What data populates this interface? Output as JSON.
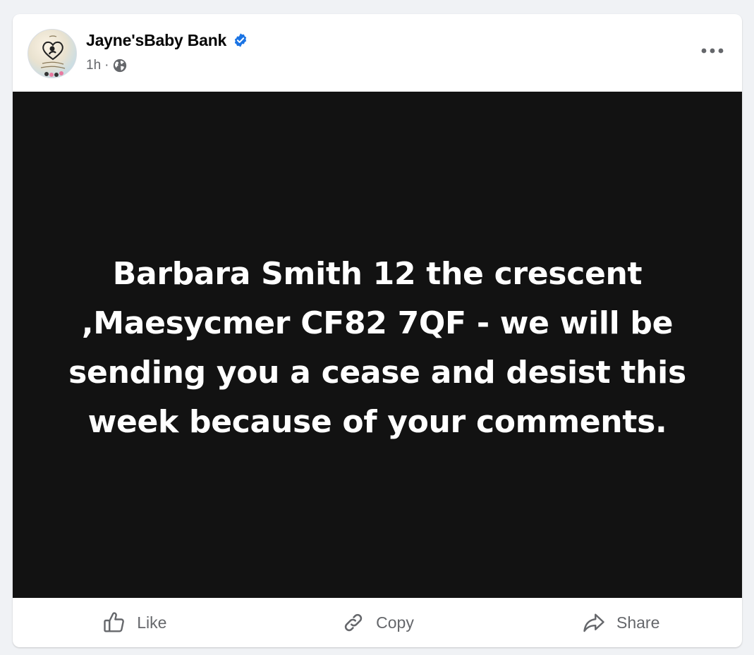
{
  "post": {
    "author": {
      "name": "Jayne'sBaby Bank",
      "verified_icon": "verified-badge-icon",
      "avatar_icon": "page-logo-avatar"
    },
    "meta": {
      "time": "1h",
      "separator": "·",
      "audience_icon": "globe-icon"
    },
    "more_icon": "more-options-icon",
    "media_text": "Barbara Smith 12 the crescent ,Maesycmer CF82 7QF - we will be sending you a cease and desist this week because of your comments.",
    "actions": [
      {
        "label": "Like",
        "icon": "like-icon"
      },
      {
        "label": "Copy",
        "icon": "link-icon"
      },
      {
        "label": "Share",
        "icon": "share-icon"
      }
    ]
  },
  "colors": {
    "page_bg": "#f0f2f5",
    "card_bg": "#ffffff",
    "media_bg": "#121212",
    "verified": "#1b74e4",
    "secondary_text": "#65676b"
  }
}
